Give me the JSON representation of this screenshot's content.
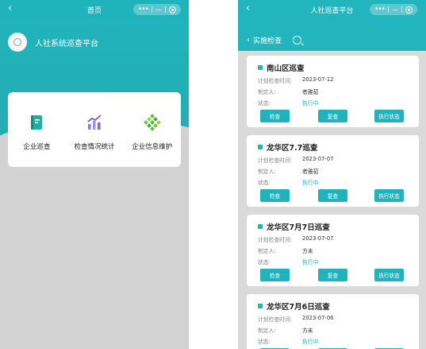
{
  "colors": {
    "accent": "#21b2bb",
    "header": "#1fb4bc",
    "background": "#d2d2d2"
  },
  "left": {
    "nav": {
      "back_icon": "chevron-left-icon",
      "title": "首页",
      "menu_icon": "more-dots-icon",
      "minimize_icon": "minus-icon",
      "close_icon": "target-icon"
    },
    "brand": {
      "logo_icon": "clock-logo-icon",
      "title": "人社系统巡查平台"
    },
    "menu": [
      {
        "icon": "document-book-icon",
        "label": "企业巡查"
      },
      {
        "icon": "bar-chart-icon",
        "label": "检查情况统计"
      },
      {
        "icon": "diamond-grid-icon",
        "label": "企业信息维护"
      }
    ]
  },
  "right": {
    "nav": {
      "back_icon": "chevron-left-icon",
      "title": "人社巡查平台",
      "menu_icon": "more-dots-icon",
      "minimize_icon": "minus-icon",
      "close_icon": "target-icon"
    },
    "subbar": {
      "back_icon": "chevron-left-icon",
      "title": "实施检查",
      "search_icon": "search-icon"
    },
    "labels": {
      "planned_time": "计划检查时间:",
      "creator": "制定人:",
      "status": "状态:"
    },
    "buttons": {
      "inspect": "检查",
      "recheck": "复查",
      "exec_status": "执行状态"
    },
    "plans": [
      {
        "name": "南山区巡查",
        "date": "2023-07-12",
        "creator": "者雅茹",
        "status": "执行中"
      },
      {
        "name": "龙华区7.7巡查",
        "date": "2023-07-07",
        "creator": "者雅茹",
        "status": "执行中"
      },
      {
        "name": "龙华区7月7日巡查",
        "date": "2023-07-07",
        "creator": "方未",
        "status": "执行中"
      },
      {
        "name": "龙华区7月6日巡查",
        "date": "2023-07-06",
        "creator": "方未",
        "status": "执行中"
      }
    ]
  }
}
